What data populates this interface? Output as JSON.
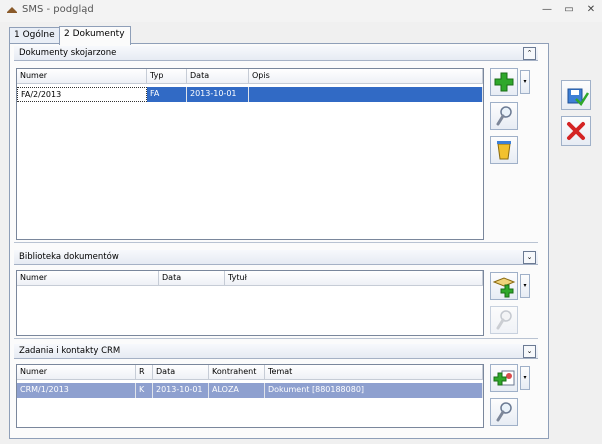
{
  "window": {
    "title": "SMS - podgląd",
    "minimize": "—",
    "maximize": "▭",
    "close": "✕"
  },
  "tabs": [
    {
      "label": "1 Ogólne"
    },
    {
      "label": "2 Dokumenty"
    }
  ],
  "sections": {
    "dokumenty": {
      "title": "Dokumenty skojarzone",
      "collapse": "⌃",
      "columns": [
        "Numer",
        "Typ",
        "Data",
        "Opis"
      ],
      "rows": [
        {
          "numer": "FA/2/2013",
          "typ": "FA",
          "data": "2013-10-01",
          "opis": ""
        }
      ]
    },
    "biblioteka": {
      "title": "Biblioteka dokumentów",
      "collapse": "⌄",
      "columns": [
        "Numer",
        "Data",
        "Tytuł"
      ],
      "rows": []
    },
    "crm": {
      "title": "Zadania i kontakty CRM",
      "collapse": "⌄",
      "columns": [
        "Numer",
        "R",
        "Data",
        "Kontrahent",
        "Temat"
      ],
      "rows": [
        {
          "numer": "CRM/1/2013",
          "r": "K",
          "data": "2013-10-01",
          "kontrahent": "ALOZA",
          "temat": "Dokument [880188080]"
        }
      ]
    }
  },
  "icons": {
    "add": "plus-icon",
    "view": "magnifier-icon",
    "delete": "trash-icon",
    "save": "save-icon",
    "cancel": "red-x-icon",
    "library_add": "library-add-icon",
    "crm_add": "crm-add-icon"
  },
  "colors": {
    "selection": "#316ac5",
    "selection_inactive": "#8ea0cf",
    "add_green": "#2fa82a",
    "cancel_red": "#d42424"
  }
}
